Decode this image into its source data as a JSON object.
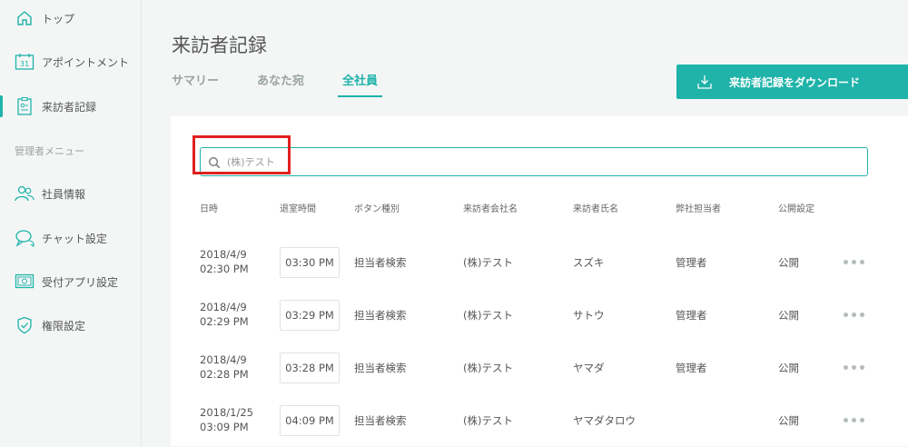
{
  "sidebar": {
    "items": [
      {
        "label": "トップ",
        "icon": "home-icon"
      },
      {
        "label": "アポイントメント",
        "icon": "calendar-icon",
        "icon_text": "31"
      },
      {
        "label": "来訪者記録",
        "icon": "visitor-record-icon"
      },
      {
        "label": "社員情報",
        "icon": "users-icon"
      },
      {
        "label": "チャット設定",
        "icon": "chat-icon"
      },
      {
        "label": "受付アプリ設定",
        "icon": "app-settings-icon"
      },
      {
        "label": "権限設定",
        "icon": "shield-icon"
      }
    ],
    "section_title": "管理者メニュー"
  },
  "page": {
    "title": "来訪者記録"
  },
  "tabs": [
    {
      "label": "サマリー"
    },
    {
      "label": "あなた宛"
    },
    {
      "label": "全社員"
    }
  ],
  "download_button": {
    "label": "来訪者記録をダウンロード"
  },
  "search": {
    "value": "(株)テスト"
  },
  "table": {
    "headers": [
      "日時",
      "退室時間",
      "ボタン種別",
      "来訪者会社名",
      "来訪者氏名",
      "弊社担当者",
      "公開設定"
    ],
    "rows": [
      {
        "date": "2018/4/9",
        "time": "02:30 PM",
        "exit": "03:30 PM",
        "button_type": "担当者検索",
        "company": "(株)テスト",
        "visitor": "スズキ",
        "staff": "管理者",
        "visibility": "公開"
      },
      {
        "date": "2018/4/9",
        "time": "02:29 PM",
        "exit": "03:29 PM",
        "button_type": "担当者検索",
        "company": "(株)テスト",
        "visitor": "サトウ",
        "staff": "管理者",
        "visibility": "公開"
      },
      {
        "date": "2018/4/9",
        "time": "02:28 PM",
        "exit": "03:28 PM",
        "button_type": "担当者検索",
        "company": "(株)テスト",
        "visitor": "ヤマダ",
        "staff": "管理者",
        "visibility": "公開"
      },
      {
        "date": "2018/1/25",
        "time": "03:09 PM",
        "exit": "04:09 PM",
        "button_type": "担当者検索",
        "company": "(株)テスト",
        "visitor": "ヤマダタロウ",
        "staff": "",
        "visibility": "公開"
      }
    ]
  },
  "colors": {
    "accent": "#1fb3a9",
    "highlight": "#e02020"
  }
}
